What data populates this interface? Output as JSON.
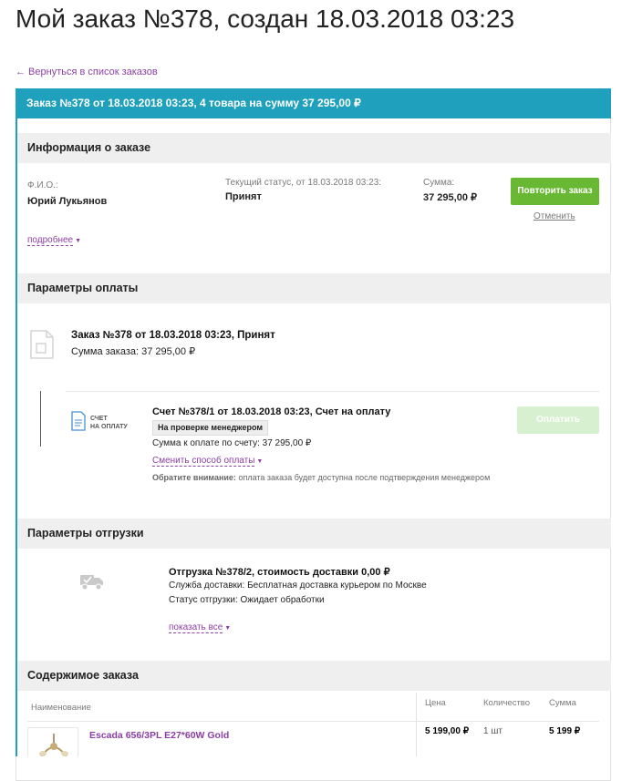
{
  "page": {
    "title": "Мой заказ №378, создан 18.03.2018 03:23",
    "back_link": "← Вернуться в список заказов"
  },
  "order_bar": {
    "text": "Заказ №378 от 18.03.2018 03:23, 4 товара на сумму 37 295,00 ₽"
  },
  "info": {
    "heading": "Информация о заказе",
    "fio_label": "Ф.И.О.:",
    "fio_value": "Юрий Лукьянов",
    "status_label": "Текущий статус, от 18.03.2018 03:23:",
    "status_value": "Принят",
    "sum_label": "Сумма:",
    "sum_value": "37 295,00 ₽",
    "repeat_button": "Повторить заказ",
    "cancel_link": "Отменить",
    "more_link": "подробнее"
  },
  "payment": {
    "heading": "Параметры оплаты",
    "order_line": "Заказ №378 от 18.03.2018 03:23, Принят",
    "order_sum": "Сумма заказа: 37 295,00 ₽",
    "invoice_icon_line1": "СЧЕТ",
    "invoice_icon_line2": "НА ОПЛАТУ",
    "invoice_title": "Счет №378/1 от 18.03.2018 03:23, Счет на оплату",
    "invoice_badge": "На проверке менеджером",
    "invoice_sum": "Сумма к оплате по счету: 37 295,00 ₽",
    "change_method_link": "Сменить способ оплаты",
    "pay_button": "Оплатить",
    "note_bold": "Обратите внимание:",
    "note_text": " оплата заказа будет доступна после подтверждения менеджером"
  },
  "shipment": {
    "heading": "Параметры отгрузки",
    "title": "Отгрузка №378/2, стоимость доставки 0,00 ₽",
    "service": "Служба доставки: Бесплатная доставка курьером по Москве",
    "status": "Статус отгрузки: Ожидает обработки",
    "show_all_link": "показать все"
  },
  "contents": {
    "heading": "Содержимое заказа",
    "columns": {
      "name": "Наименование",
      "price": "Цена",
      "qty": "Количество",
      "sum": "Сумма"
    },
    "rows": [
      {
        "name": "Escada 656/3PL E27*60W Gold",
        "price": "5 199,00 ₽",
        "qty": "1 шт",
        "sum": "5 199 ₽"
      }
    ]
  },
  "colors": {
    "accent": "#1fa0bd",
    "link": "#8b3fa3",
    "button_green": "#68b833"
  }
}
